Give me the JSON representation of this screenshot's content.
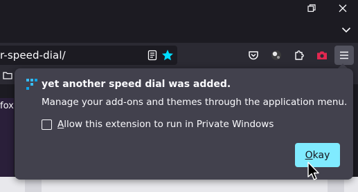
{
  "navbar": {
    "url_text": "r-speed-dial/"
  },
  "page_behind": {
    "left_text": "fox"
  },
  "doorhanger": {
    "title": "yet another speed dial was added.",
    "message": "Manage your add-ons and themes through the application menu.",
    "private_checkbox": {
      "label_accesskey": "A",
      "label_rest": "llow this extension to run in Private Windows",
      "checked": false
    },
    "okay_button": {
      "label_accesskey": "O",
      "label_rest": "kay"
    }
  },
  "colors": {
    "panel_bg": "#42414d",
    "accent_button": "#80ebff",
    "star_blue": "#00ddff",
    "screenshot_red": "#e22850"
  },
  "icons": [
    "restore-window-icon",
    "close-window-icon",
    "chevron-down-icon",
    "reader-view-icon",
    "bookmark-star-icon",
    "pocket-icon",
    "extension-ball-icon",
    "puzzle-icon",
    "camera-icon",
    "hamburger-menu-icon",
    "speed-dial-addon-icon",
    "mouse-pointer-icon"
  ]
}
